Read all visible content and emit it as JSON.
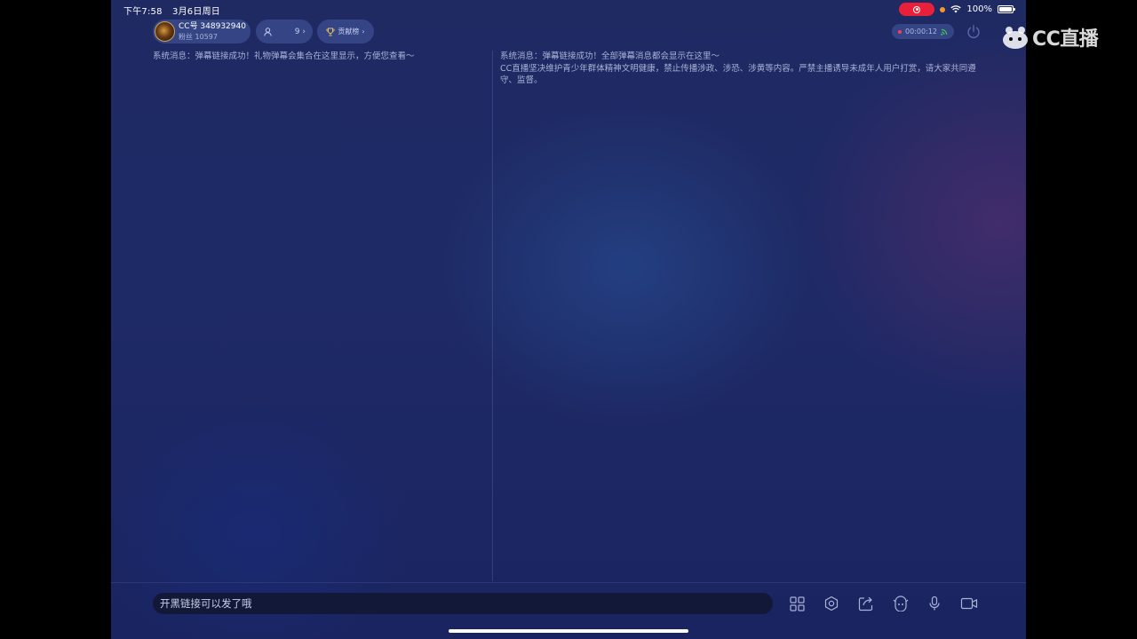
{
  "status_bar": {
    "time": "下午7:58",
    "date": "3月6日周日",
    "battery": "100%"
  },
  "anchor": {
    "cc_id": "CC号 348932940",
    "fans": "粉丝 10597"
  },
  "viewers": {
    "count": "9",
    "chevron": "›"
  },
  "rank": {
    "label": "贡献榜",
    "chevron": "›"
  },
  "live_timer": "00:00:12",
  "gift_messages": [
    "系统消息：弹幕链接成功！礼物弹幕会集合在这里显示，方便您查看～"
  ],
  "chat_messages": [
    "系统消息：弹幕链接成功！全部弹幕消息都会显示在这里～",
    "CC直播坚决维护青少年群体精神文明健康，禁止传播涉政、涉恐、涉黄等内容。严禁主播诱导未成年人用户打赏，请大家共同遵守、监督。"
  ],
  "input": {
    "placeholder": "开黑链接可以发了哦"
  },
  "toolbar": {
    "icons": [
      "grid-icon",
      "settings-icon",
      "share-icon",
      "beauty-icon",
      "microphone-icon",
      "camera-icon"
    ]
  },
  "watermark": {
    "text": "CC直播"
  },
  "colors": {
    "accent_red": "#e8203a",
    "orange_dot": "#f29a2e",
    "live_dot": "#ff3a5a",
    "signal_green": "#3ecf5a"
  }
}
